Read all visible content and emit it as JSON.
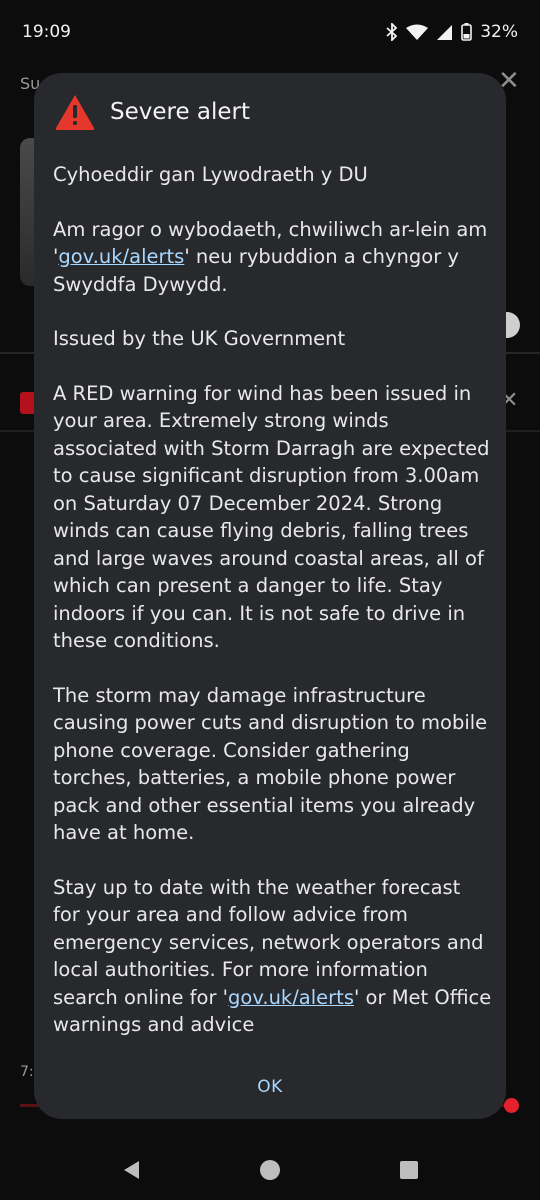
{
  "status_bar": {
    "time": "19:09",
    "battery_text": "32%",
    "icons": [
      "bluetooth-icon",
      "wifi-icon",
      "signal-icon",
      "battery-icon"
    ]
  },
  "background": {
    "title_fragment": "Su",
    "time_fragment": "7:"
  },
  "alert": {
    "title": "Severe alert",
    "icon": "warning-triangle-icon",
    "icon_color": "#e5372c",
    "link_color": "#a8d8ff",
    "paragraphs": {
      "p1": "Cyhoeddir gan Lywodraeth y DU",
      "p2_before": "Am ragor o wybodaeth, chwiliwch ar-lein am '",
      "p2_link": "gov.uk/alerts",
      "p2_after": "' neu rybuddion a chyngor y Swyddfa Dywydd.",
      "p3": "Issued by the UK Government",
      "p4": "A RED warning for wind has been issued in your area. Extremely strong winds associated with Storm Darragh are expected to cause significant disruption from 3.00am on Saturday 07 December 2024. Strong winds can cause flying debris, falling trees and large waves around coastal areas, all of which can present a danger to life. Stay indoors if you can. It is not safe to drive in these conditions.",
      "p5": "The storm may damage infrastructure causing power cuts and disruption to mobile phone coverage. Consider gathering torches, batteries, a mobile phone power pack and other essential items you already have at home.",
      "p6_before": "Stay up to date with the weather forecast for your area and follow advice from emergency services, network operators and local authorities. For more information search online for '",
      "p6_link": "gov.uk/alerts",
      "p6_after": "' or Met Office warnings and advice"
    },
    "ok_label": "OK"
  },
  "nav_bar": {
    "icons": [
      "back-icon",
      "home-icon",
      "recents-icon"
    ]
  }
}
